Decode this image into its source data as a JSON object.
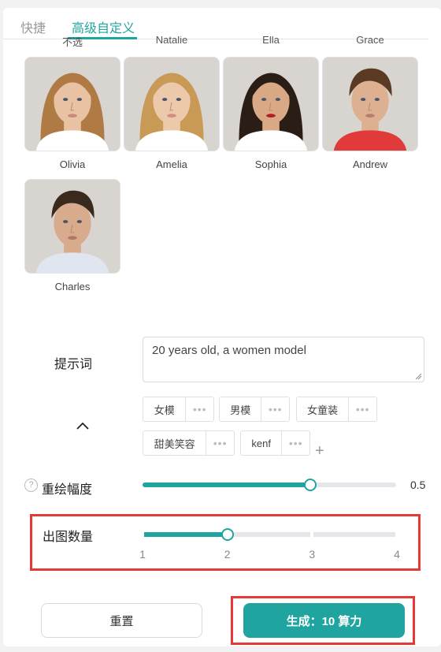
{
  "tabs": {
    "quick": "快捷",
    "advanced": "高级自定义"
  },
  "cut_names": [
    "不选",
    "Natalie",
    "Ella",
    "Grace"
  ],
  "models": [
    {
      "name": "Olivia",
      "hair": "#b07a45",
      "skin": "#e8c2a2",
      "lips": "#c98b80",
      "top": "#ffffff"
    },
    {
      "name": "Amelia",
      "hair": "#c99a55",
      "skin": "#ecc9ab",
      "lips": "#cf8f85",
      "top": "#ffffff"
    },
    {
      "name": "Sophia",
      "hair": "#2a1d16",
      "skin": "#d9a985",
      "lips": "#b0202a",
      "top": "#ffffff"
    },
    {
      "name": "Andrew",
      "hair": "#5a3a22",
      "skin": "#dcb091",
      "lips": "#b97d6e",
      "top": "#e03a3a"
    },
    {
      "name": "Charles",
      "hair": "#3a2a1e",
      "skin": "#d7ab8c",
      "lips": "#b07767",
      "top": "#dfe6ef"
    }
  ],
  "prompt": {
    "label": "提示词",
    "value": "20 years old, a women model"
  },
  "tags": [
    {
      "label": "女模",
      "more": "•••"
    },
    {
      "label": "男模",
      "more": "•••"
    },
    {
      "label": "女童装",
      "more": "•••"
    },
    {
      "label": "甜美笑容",
      "more": "•••"
    },
    {
      "label": "kenf",
      "more": "•••"
    }
  ],
  "add_tag": "+",
  "redraw": {
    "label": "重绘幅度",
    "help": "?",
    "value": "0.5",
    "level": 0.66
  },
  "count": {
    "label": "出图数量",
    "ticks": [
      "1",
      "2",
      "3",
      "4"
    ],
    "selected": 2
  },
  "buttons": {
    "reset": "重置",
    "generate": "生成：10 算力"
  },
  "colors": {
    "accent": "#20a4a0",
    "highlight": "#e53935"
  }
}
